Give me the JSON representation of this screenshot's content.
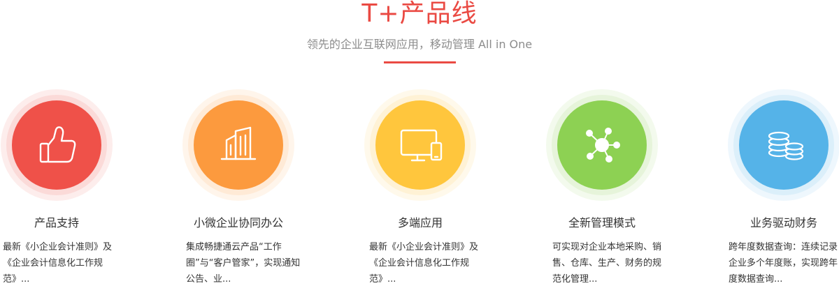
{
  "header": {
    "title": "T+产品线",
    "subtitle": "领先的企业互联网应用，移动管理 All in One"
  },
  "colors": {
    "accent": "#ea4a43",
    "red": "#ef5149",
    "orange": "#fc9a3e",
    "yellow": "#ffc63d",
    "green": "#8dd153",
    "blue": "#55b3e8"
  },
  "features": [
    {
      "icon": "thumbs-up-icon",
      "title": "产品支持",
      "description": "最新《小企业会计准则》及《企业会计信息化工作规范》..."
    },
    {
      "icon": "buildings-icon",
      "title": "小微企业协同办公",
      "description": "集成畅捷通云产品“工作圈”与“客户管家”，实现通知公告、业..."
    },
    {
      "icon": "monitor-tablet-icon",
      "title": "多端应用",
      "description": "最新《小企业会计准则》及《企业会计信息化工作规范》..."
    },
    {
      "icon": "network-hub-icon",
      "title": "全新管理模式",
      "description": "可实现对企业本地采购、销售、仓库、生产、财务的规范化管理..."
    },
    {
      "icon": "coin-stack-icon",
      "title": "业务驱动财务",
      "description": "跨年度数据查询：连续记录企业多个年度账，实现跨年度数据查询..."
    }
  ]
}
